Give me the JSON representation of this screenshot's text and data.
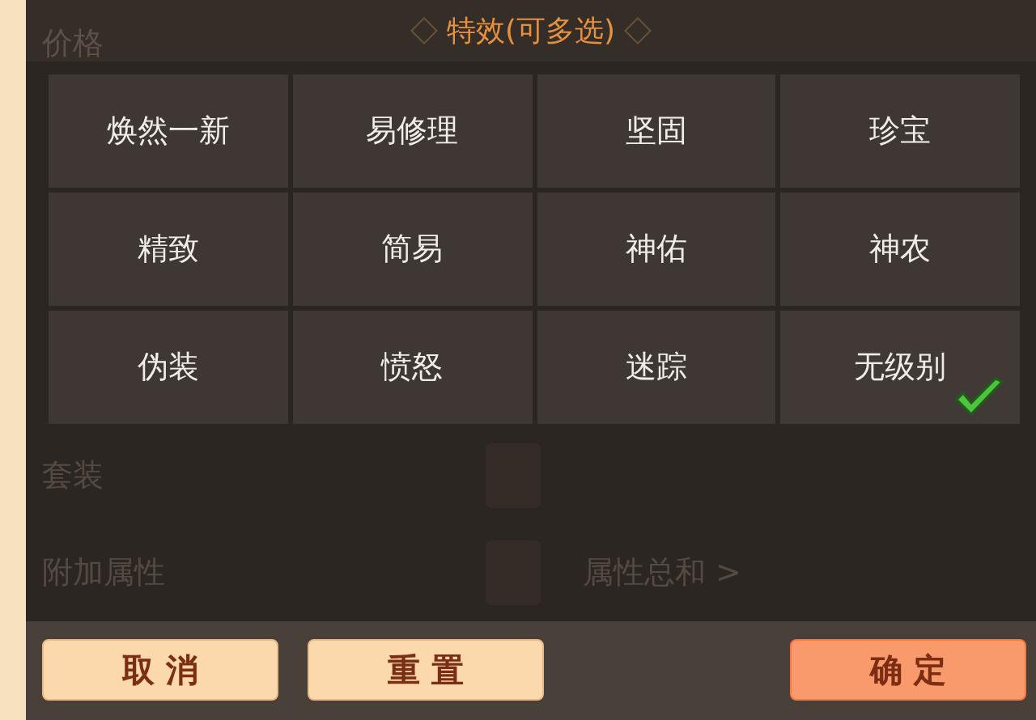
{
  "dialog": {
    "title": "特效(可多选)"
  },
  "options": [
    {
      "label": "焕然一新",
      "selected": false
    },
    {
      "label": "易修理",
      "selected": false
    },
    {
      "label": "坚固",
      "selected": false
    },
    {
      "label": "珍宝",
      "selected": false
    },
    {
      "label": "精致",
      "selected": false
    },
    {
      "label": "简易",
      "selected": false
    },
    {
      "label": "神佑",
      "selected": false
    },
    {
      "label": "神农",
      "selected": false
    },
    {
      "label": "伪装",
      "selected": false
    },
    {
      "label": "愤怒",
      "selected": false
    },
    {
      "label": "迷踪",
      "selected": false
    },
    {
      "label": "无级别",
      "selected": true
    }
  ],
  "background_form": {
    "price_label": "价格",
    "rows": [
      {
        "label": "套装"
      },
      {
        "label": "附加属性",
        "extra": "属性总和 >"
      }
    ]
  },
  "buttons": [
    {
      "label": "取 消",
      "kind": "secondary"
    },
    {
      "label": "重 置",
      "kind": "secondary"
    },
    {
      "label": "确 定",
      "kind": "primary"
    }
  ]
}
